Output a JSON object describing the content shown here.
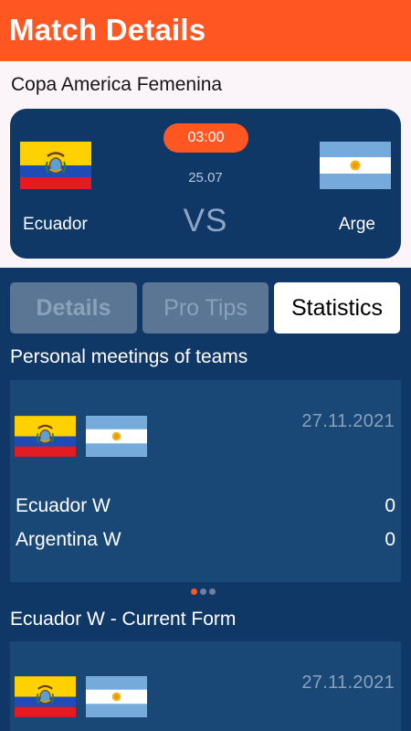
{
  "header": {
    "title": "Match Details"
  },
  "match": {
    "league": "Copa America Femenina",
    "time": "03:00",
    "date": "25.07",
    "vs_label": "VS",
    "home_team": {
      "name": "Ecuador",
      "flag": "ecuador-flag-icon"
    },
    "away_team": {
      "name": "Arge",
      "flag": "argentina-flag-icon"
    }
  },
  "tabs": [
    {
      "label": "Details",
      "active": false
    },
    {
      "label": "Pro Tips",
      "active": false
    },
    {
      "label": "Statistics",
      "active": true
    }
  ],
  "personal_meetings": {
    "title": "Personal meetings of teams",
    "games": [
      {
        "date": "27.11.2021",
        "home": {
          "name": "Ecuador W",
          "score": "0"
        },
        "away": {
          "name": "Argentina W",
          "score": "0"
        }
      }
    ],
    "pager": {
      "count": 3,
      "active_index": 0
    }
  },
  "current_form": {
    "title": "Ecuador W - Current Form",
    "games": [
      {
        "date": "27.11.2021"
      }
    ]
  },
  "colors": {
    "accent": "#ff5622",
    "navy": "#0f3866",
    "card": "#1a4876",
    "tab_inactive": "#5b7594",
    "top_background": "#fbf4f8"
  }
}
